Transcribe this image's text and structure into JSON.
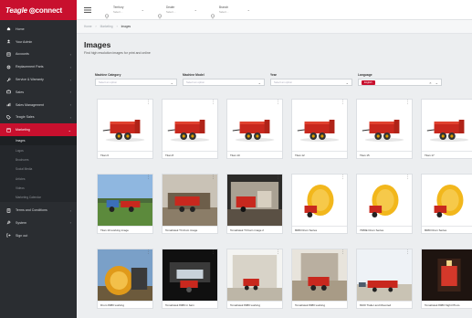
{
  "app": {
    "logo_brand": "Teagle",
    "logo_product": "connect"
  },
  "topbar": {
    "selectors": [
      {
        "label": "Territory",
        "value": "Select…"
      },
      {
        "label": "Dealer",
        "value": "Select…"
      },
      {
        "label": "Branch",
        "value": "Select…"
      }
    ]
  },
  "sidebar": {
    "items": [
      {
        "label": "Home",
        "icon": "home-icon"
      },
      {
        "label": "Your Admin",
        "icon": "user-icon"
      },
      {
        "label": "Accounts",
        "icon": "accounts-icon",
        "chevron": true
      },
      {
        "label": "Replacement Parts",
        "icon": "parts-icon",
        "chevron": true
      },
      {
        "label": "Service & Warranty",
        "icon": "wrench-icon",
        "chevron": true
      },
      {
        "label": "Sales",
        "icon": "sales-icon",
        "chevron": true
      },
      {
        "label": "Sales Management",
        "icon": "chart-icon",
        "chevron": true
      },
      {
        "label": "Teagle Sales",
        "icon": "tag-icon",
        "chevron": true
      },
      {
        "label": "Marketing",
        "icon": "marketing-icon",
        "chevron": true,
        "active": true
      }
    ],
    "subitems": [
      {
        "label": "Images",
        "active": true
      },
      {
        "label": "Logos"
      },
      {
        "label": "Brochures"
      },
      {
        "label": "Social Media"
      },
      {
        "label": "Articles"
      },
      {
        "label": "Videos"
      },
      {
        "label": "Marketing Calendar"
      }
    ],
    "bottom_items": [
      {
        "label": "Terms and Conditions",
        "icon": "terms-icon",
        "chevron": true
      },
      {
        "label": "System",
        "icon": "system-icon",
        "chevron": true
      },
      {
        "label": "Sign out",
        "icon": "signout-icon"
      }
    ]
  },
  "breadcrumb": [
    "Home",
    "Marketing",
    "Images"
  ],
  "page": {
    "title": "Images",
    "subtitle": "Find high resolution images for print and online"
  },
  "filters": {
    "category": {
      "label": "Machine Category",
      "placeholder": "Select an option"
    },
    "model": {
      "label": "Machine Model",
      "placeholder": "Select an option"
    },
    "year": {
      "label": "Year",
      "placeholder": "Select an option"
    },
    "language": {
      "label": "Language",
      "value": "English"
    }
  },
  "images": [
    {
      "caption": "Titan 6",
      "kind": "spreader"
    },
    {
      "caption": "Titan 8",
      "kind": "spreader"
    },
    {
      "caption": "Titan 10",
      "kind": "spreader"
    },
    {
      "caption": "Titan 12",
      "kind": "spreader"
    },
    {
      "caption": "Titan 15",
      "kind": "spreader"
    },
    {
      "caption": "Titan 17",
      "kind": "spreader"
    },
    {
      "caption": "Titan 10 working image",
      "kind": "field"
    },
    {
      "caption": "Tomahawk T3 drum image",
      "kind": "barn"
    },
    {
      "caption": "Tomahawk T3 barn image 2",
      "kind": "barn2"
    },
    {
      "caption": "8080 Drum Series",
      "kind": "drum"
    },
    {
      "caption": "7080E Drum Series",
      "kind": "drum"
    },
    {
      "caption": "8080 Drum Series",
      "kind": "drum"
    },
    {
      "caption": "Drum 8080 working",
      "kind": "closeup"
    },
    {
      "caption": "Tomahawk 8080 in barn",
      "kind": "dark"
    },
    {
      "caption": "Tomahawk 8080 working",
      "kind": "shed"
    },
    {
      "caption": "Tomahawk 8080 working",
      "kind": "shed2"
    },
    {
      "caption": "8100 Trailer and Mounted",
      "kind": "outdoor"
    },
    {
      "caption": "Tomahawk 8080 Night Photo",
      "kind": "night"
    }
  ],
  "colors": {
    "brand_red": "#c8102e",
    "sidebar": "#2a2d31",
    "background": "#eceef0"
  }
}
